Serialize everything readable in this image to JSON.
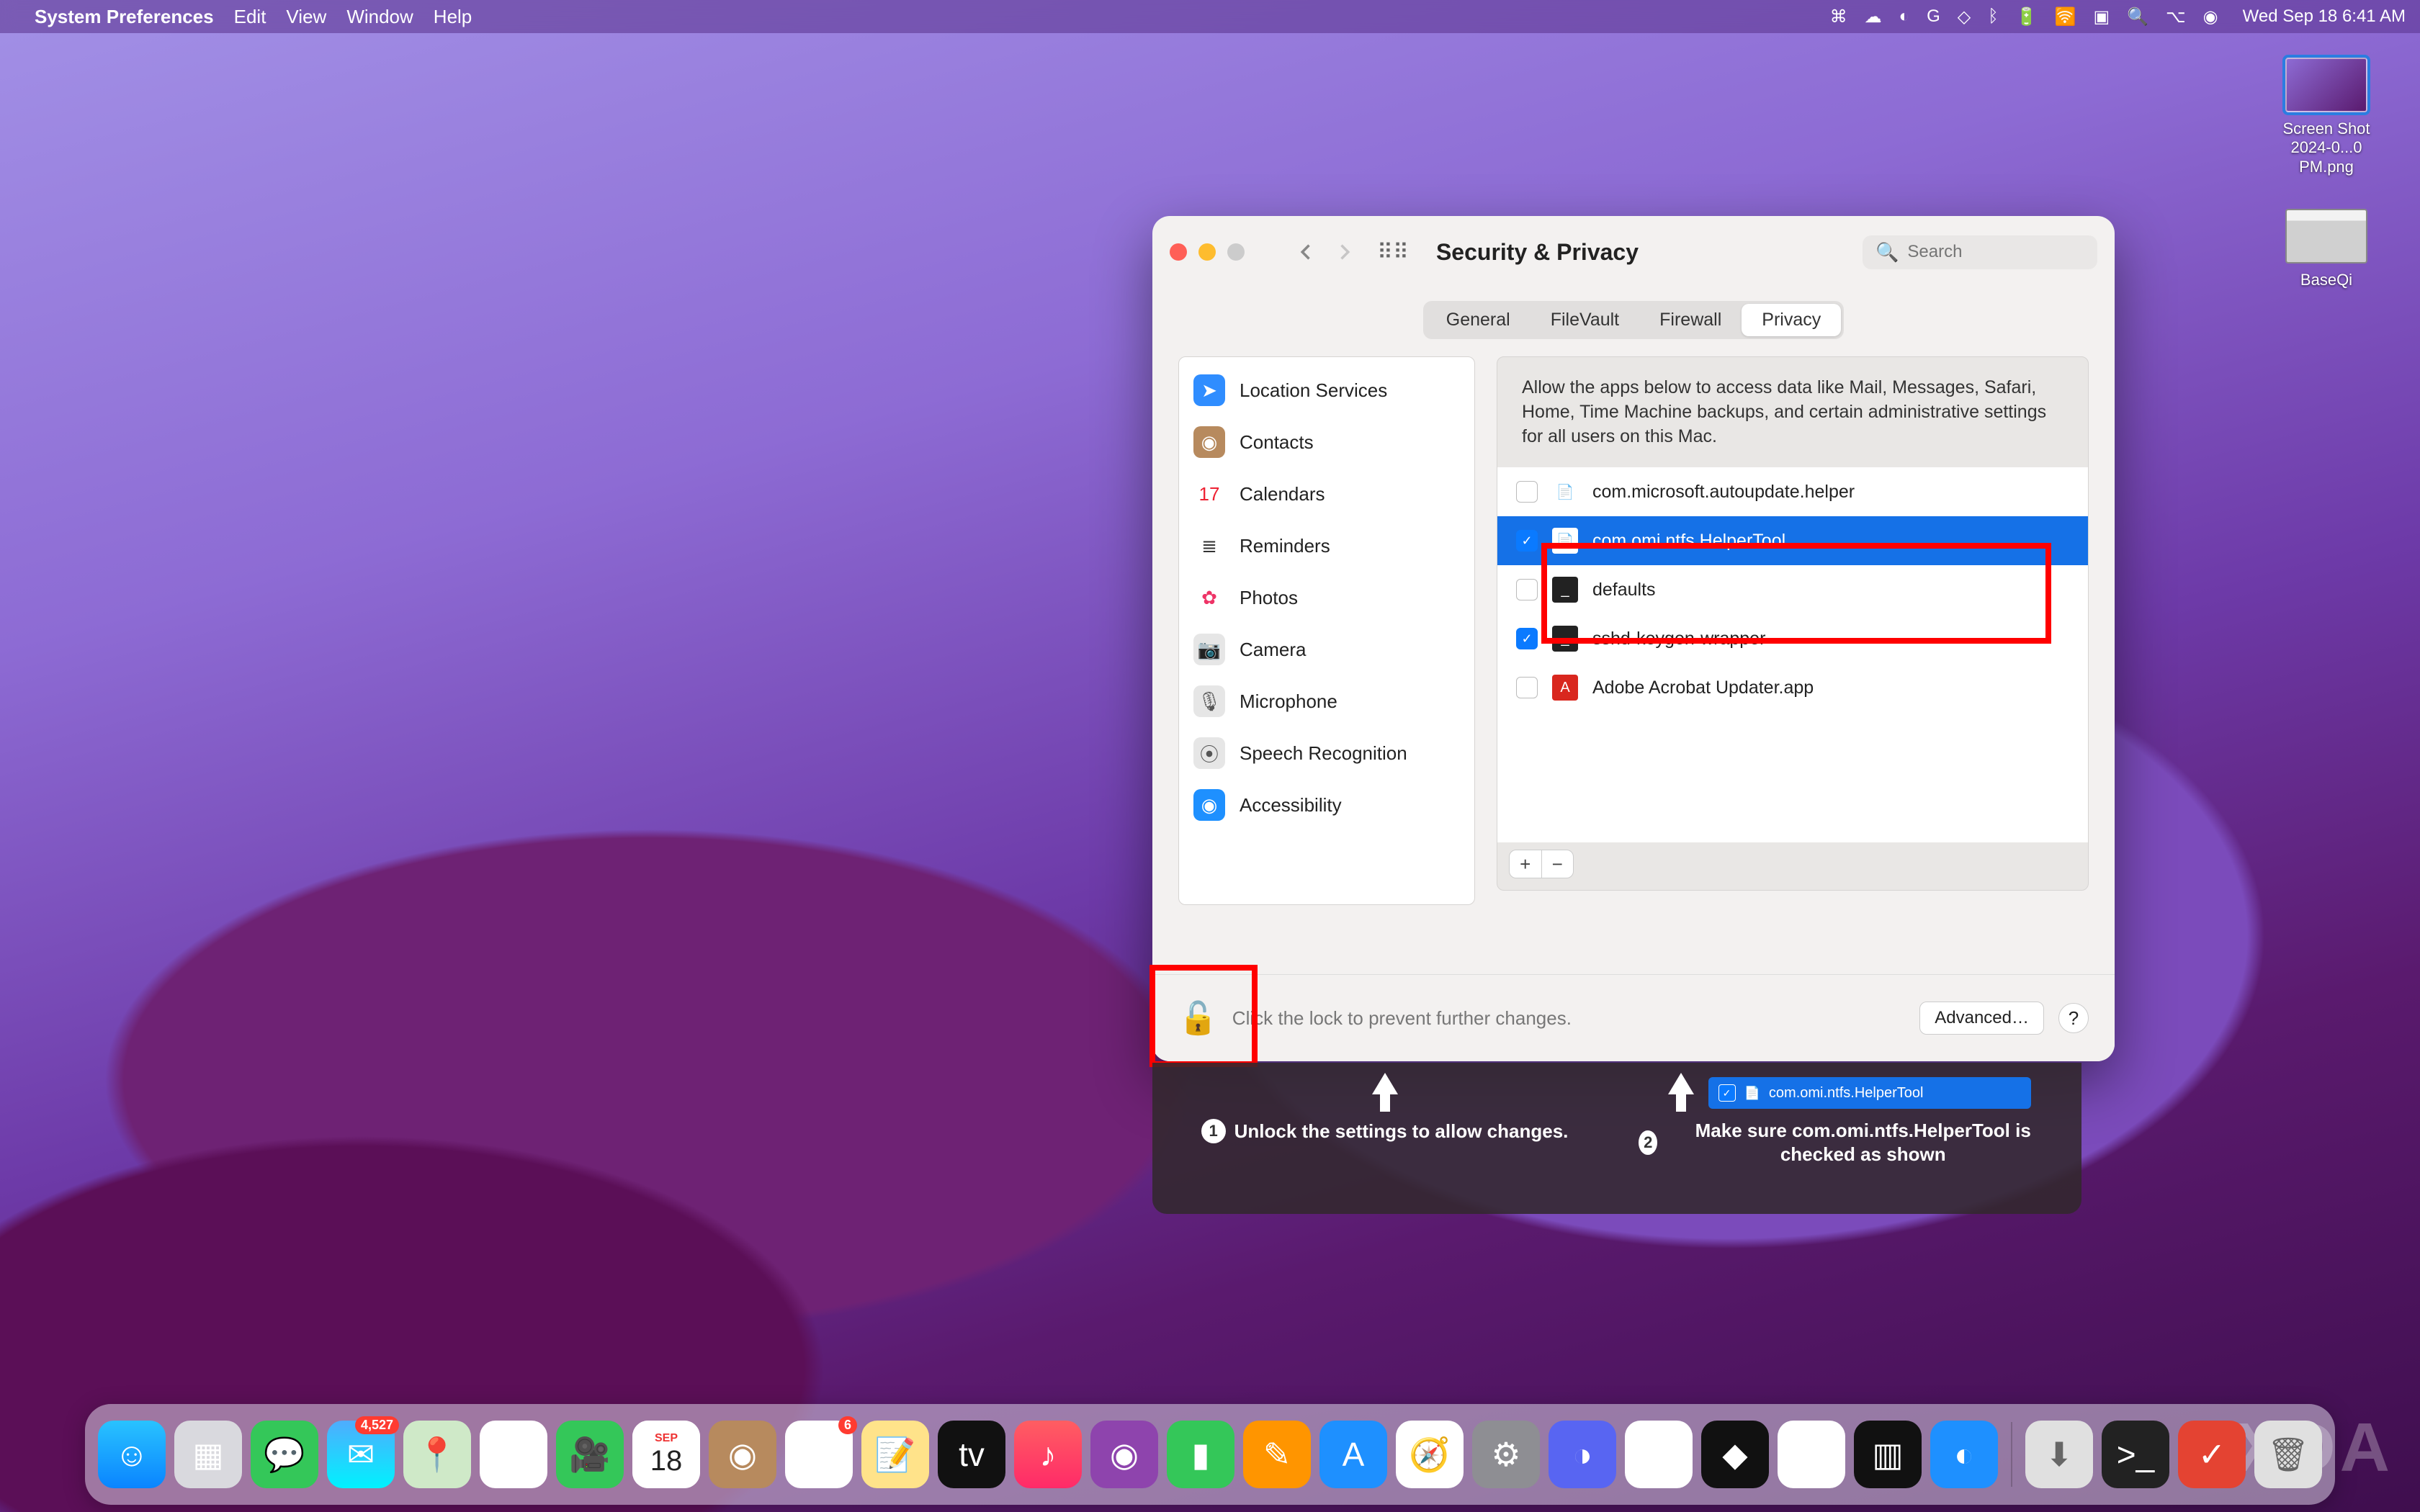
{
  "menubar": {
    "app_label": "System Preferences",
    "menus": [
      "Edit",
      "View",
      "Window",
      "Help"
    ],
    "clock": "Wed Sep 18  6:41 AM"
  },
  "desktop": {
    "icon1_label": "Screen Shot 2024-0...0 PM.png",
    "icon2_label": "BaseQi"
  },
  "watermark": "XDA",
  "window": {
    "title": "Security & Privacy",
    "search_placeholder": "Search",
    "tabs": {
      "general": "General",
      "filevault": "FileVault",
      "firewall": "Firewall",
      "privacy": "Privacy"
    },
    "categories": [
      {
        "label": "Location Services",
        "color": "#2f8dff",
        "glyph": "➤"
      },
      {
        "label": "Contacts",
        "color": "#b78a5e",
        "glyph": "◉"
      },
      {
        "label": "Calendars",
        "color": "#ffffff",
        "glyph": "17",
        "text": "#e23"
      },
      {
        "label": "Reminders",
        "color": "#ffffff",
        "glyph": "≣",
        "text": "#333"
      },
      {
        "label": "Photos",
        "color": "#ffffff",
        "glyph": "✿",
        "text": "#e36"
      },
      {
        "label": "Camera",
        "color": "#e6e6e6",
        "glyph": "📷",
        "text": "#555"
      },
      {
        "label": "Microphone",
        "color": "#e6e6e6",
        "glyph": "🎙",
        "text": "#555"
      },
      {
        "label": "Speech Recognition",
        "color": "#e6e6e6",
        "glyph": "⦿",
        "text": "#555"
      },
      {
        "label": "Accessibility",
        "color": "#1e90ff",
        "glyph": "◉"
      }
    ],
    "description": "Allow the apps below to access data like Mail, Messages, Safari, Home, Time Machine backups, and certain administrative settings for all users on this Mac.",
    "apps": [
      {
        "label": "com.microsoft.autoupdate.helper",
        "checked": false,
        "selected": false,
        "icon_bg": "#fff",
        "icon_glyph": "📄"
      },
      {
        "label": "com.omi.ntfs.HelperTool",
        "checked": true,
        "selected": true,
        "icon_bg": "#fff",
        "icon_glyph": "📄"
      },
      {
        "label": "defaults",
        "checked": false,
        "selected": false,
        "icon_bg": "#222",
        "icon_glyph": "_"
      },
      {
        "label": "sshd-keygen-wrapper",
        "checked": true,
        "selected": false,
        "icon_bg": "#222",
        "icon_glyph": "_"
      },
      {
        "label": "Adobe Acrobat Updater.app",
        "checked": false,
        "selected": false,
        "icon_bg": "#d9271e",
        "icon_glyph": "A"
      }
    ],
    "lock_text": "Click the lock to prevent further changes.",
    "advanced": "Advanced…",
    "help": "?"
  },
  "instructions": {
    "step1": "Unlock the settings to allow changes.",
    "step2": "Make sure com.omi.ntfs.HelperTool is checked as shown",
    "mini_label": "com.omi.ntfs.HelperTool"
  },
  "dock": {
    "tiles": [
      {
        "name": "finder",
        "bg": "linear-gradient(#29c3ff,#0a84ff)",
        "glyph": "☺"
      },
      {
        "name": "launchpad",
        "bg": "#d9d9de",
        "glyph": "▦"
      },
      {
        "name": "messages",
        "bg": "#34c759",
        "glyph": "💬"
      },
      {
        "name": "mail",
        "bg": "linear-gradient(#4facfe,#00f2fe)",
        "glyph": "✉",
        "badge": "4,527"
      },
      {
        "name": "maps",
        "bg": "#cfe9c8",
        "glyph": "📍"
      },
      {
        "name": "photos",
        "bg": "#fff",
        "glyph": "✿"
      },
      {
        "name": "facetime",
        "bg": "#34c759",
        "glyph": "🎥"
      },
      {
        "name": "calendar",
        "bg": "#fff",
        "glyph": "18"
      },
      {
        "name": "contacts",
        "bg": "#b78a5e",
        "glyph": "◉"
      },
      {
        "name": "reminders",
        "bg": "#fff",
        "glyph": "≣",
        "badge": "6"
      },
      {
        "name": "notes",
        "bg": "#ffe38a",
        "glyph": "📝"
      },
      {
        "name": "tv",
        "bg": "#111",
        "glyph": "tv"
      },
      {
        "name": "music",
        "bg": "linear-gradient(#ff5e62,#ff2a68)",
        "glyph": "♪"
      },
      {
        "name": "podcasts",
        "bg": "#8e44ad",
        "glyph": "◉"
      },
      {
        "name": "numbers",
        "bg": "#34c759",
        "glyph": "▮"
      },
      {
        "name": "pages",
        "bg": "#ff9500",
        "glyph": "✎"
      },
      {
        "name": "appstore",
        "bg": "#1e90ff",
        "glyph": "A"
      },
      {
        "name": "safari",
        "bg": "#fff",
        "glyph": "🧭"
      },
      {
        "name": "sysprefs",
        "bg": "#8e8e93",
        "glyph": "⚙"
      },
      {
        "name": "discord",
        "bg": "#5865f2",
        "glyph": "◑"
      },
      {
        "name": "slack",
        "bg": "#fff",
        "glyph": "✳"
      },
      {
        "name": "obsidian",
        "bg": "#111",
        "glyph": "◆"
      },
      {
        "name": "chrome",
        "bg": "#fff",
        "glyph": "◉"
      },
      {
        "name": "istat",
        "bg": "#111",
        "glyph": "▥"
      },
      {
        "name": "cleanmymac",
        "bg": "#1e90ff",
        "glyph": "◐"
      }
    ],
    "right": [
      {
        "name": "downloads",
        "bg": "#e0e0e0",
        "glyph": "⬇"
      },
      {
        "name": "terminal",
        "bg": "#222",
        "glyph": ">_"
      },
      {
        "name": "todoist",
        "bg": "#e44332",
        "glyph": "✓"
      },
      {
        "name": "trash",
        "bg": "#e0e0e0",
        "glyph": "🗑"
      }
    ]
  }
}
